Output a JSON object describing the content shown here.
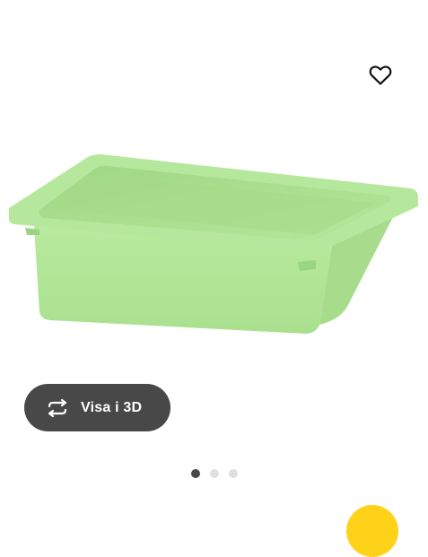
{
  "product_image": {
    "description_icon": "green-storage-box-image",
    "box_color": "#b5e89c",
    "box_shade": "#9fd985"
  },
  "favorite": {
    "icon": "heart-outline-icon"
  },
  "view_3d": {
    "label": "Visa i 3D",
    "icon": "rotate-arrows-icon",
    "background": "#484848"
  },
  "carousel": {
    "dots": [
      {
        "active": true
      },
      {
        "active": false
      },
      {
        "active": false
      }
    ]
  },
  "floating_action": {
    "color": "#ffd21a"
  }
}
